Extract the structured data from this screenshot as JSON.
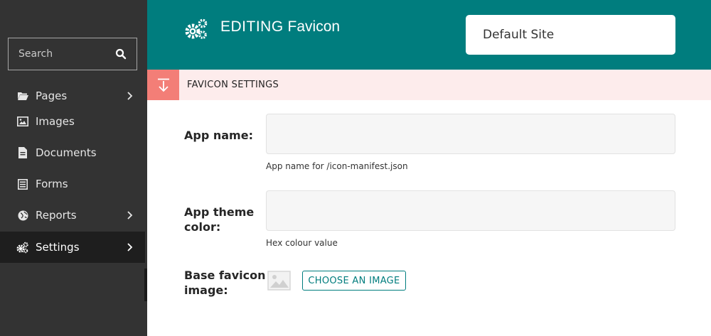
{
  "sidebar": {
    "search_placeholder": "Search",
    "items": [
      {
        "label": "Pages",
        "icon": "folder-open-icon",
        "has_submenu": true
      },
      {
        "label": "Images",
        "icon": "image-icon",
        "has_submenu": false
      },
      {
        "label": "Documents",
        "icon": "document-icon",
        "has_submenu": false
      },
      {
        "label": "Forms",
        "icon": "form-icon",
        "has_submenu": false
      },
      {
        "label": "Reports",
        "icon": "globe-icon",
        "has_submenu": true
      },
      {
        "label": "Settings",
        "icon": "cogs-icon",
        "has_submenu": true,
        "active": true
      }
    ]
  },
  "header": {
    "title_prefix": "EDITING",
    "title_name": "Favicon",
    "site": "Default Site"
  },
  "section": {
    "title": "FAVICON SETTINGS"
  },
  "form": {
    "app_name": {
      "label": "App name:",
      "value": "",
      "help": "App name for /icon-manifest.json"
    },
    "theme_color": {
      "label_line1": "App theme",
      "label_line2": "color:",
      "value": "",
      "help": "Hex colour value"
    },
    "base_image": {
      "label_line1": "Base favicon",
      "label_line2": "image:",
      "button": "CHOOSE AN IMAGE"
    }
  },
  "colors": {
    "header_bg": "#007d7e",
    "sidebar_bg": "#333333",
    "section_bg": "#fdecec",
    "section_toggle": "#f37e77",
    "accent": "#007d7e"
  }
}
